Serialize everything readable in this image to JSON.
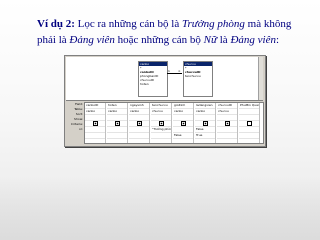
{
  "slide": {
    "example_label": "Ví dụ 2:",
    "line1_a": " Lọc ra những cán bộ là ",
    "line1_em": "Trưởng phòng",
    "line1_b": " mà không phải là ",
    "line2_em1": "Đảng viên",
    "line2_b": " hoặc những cán bộ ",
    "line2_em2": "Nữ",
    "line2_c": " là ",
    "line2_em3": "Đảng viên",
    "line2_d": ":"
  },
  "query": {
    "table1": {
      "title": "canbo",
      "fields": [
        "*",
        "canboID",
        "phongbanID",
        "chucvuID",
        "hoten"
      ]
    },
    "table2": {
      "title": "chucvu",
      "fields": [
        "*",
        "chucvuID",
        "tenchucvu"
      ]
    },
    "relation": {
      "left": "1",
      "right": "∞"
    },
    "grid_row_labels": [
      "Field:",
      "Table:",
      "Sort:",
      "Show:",
      "Criteria:",
      "or:"
    ],
    "columns": [
      {
        "field": "canboID",
        "table": "canbo",
        "show": true,
        "criteria": "",
        "or": ""
      },
      {
        "field": "hoten",
        "table": "canbo",
        "show": true,
        "criteria": "",
        "or": ""
      },
      {
        "field": "ngaysinh",
        "table": "canbo",
        "show": true,
        "criteria": "",
        "or": ""
      },
      {
        "field": "tenchucvu",
        "table": "chucvu",
        "show": true,
        "criteria": "\"Trưởng phòng\"",
        "or": ""
      },
      {
        "field": "gioitinh",
        "table": "canbo",
        "show": true,
        "criteria": "",
        "or": "False"
      },
      {
        "field": "ladangvien",
        "table": "canbo",
        "show": true,
        "criteria": "False",
        "or": "True"
      },
      {
        "field": "chucvuID",
        "table": "chucvu",
        "show": true,
        "criteria": "",
        "or": ""
      },
      {
        "field": "PhuMin Quang",
        "table": "",
        "show": false,
        "criteria": "",
        "or": ""
      }
    ]
  }
}
